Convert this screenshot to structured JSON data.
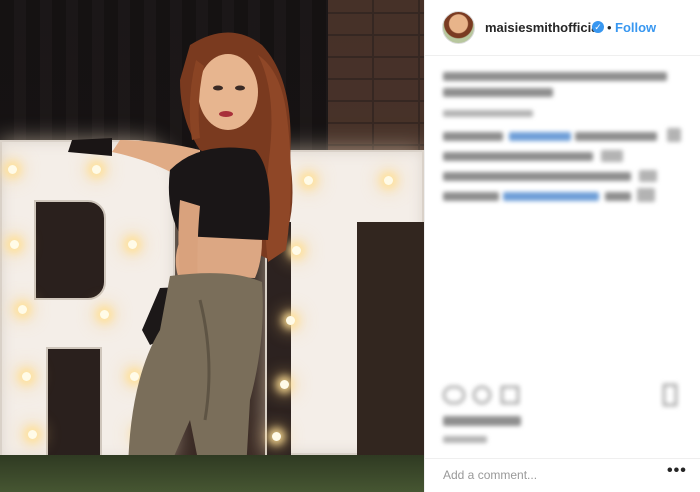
{
  "post": {
    "username": "maisiesmithofficial",
    "separator": "•",
    "follow_label": "Follow",
    "verified_icon": "verified-badge-icon",
    "comment_placeholder": "Add a comment...",
    "more_label": "•••",
    "photo_letters": "RT"
  },
  "colors": {
    "link_blue": "#3897f0",
    "text": "#262626",
    "placeholder": "#999999",
    "divider": "#efefef"
  },
  "icons": [
    "verified-badge-icon",
    "heart-icon",
    "comment-icon",
    "share-icon",
    "bookmark-icon",
    "more-options-icon"
  ]
}
